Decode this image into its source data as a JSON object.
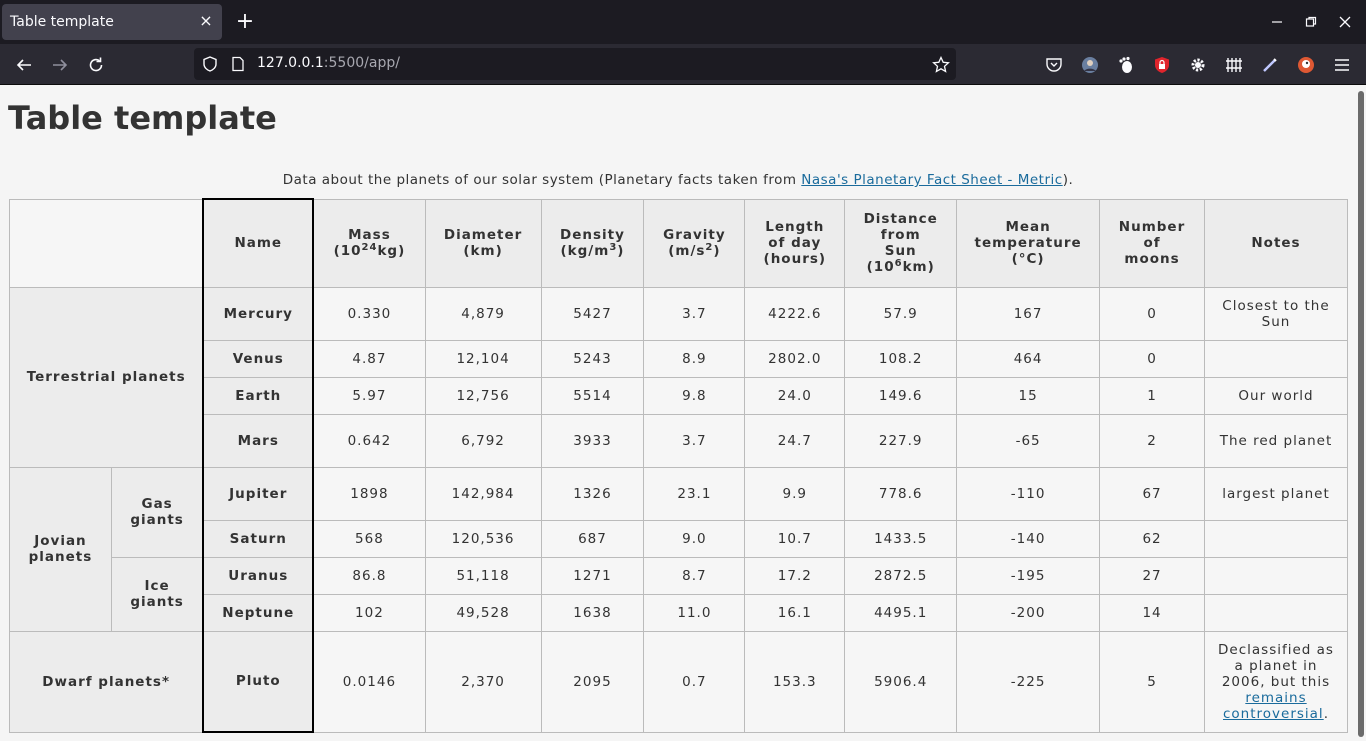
{
  "browser": {
    "tab_title": "Table template",
    "tab_close": "×",
    "new_tab": "+",
    "url_host": "127.0.0.1",
    "url_rest": ":5500/app/"
  },
  "page": {
    "title": "Table template",
    "caption_prefix": "Data about the planets of our solar system (Planetary facts taken from ",
    "caption_link": "Nasa's Planetary Fact Sheet - Metric",
    "caption_suffix": ")."
  },
  "table": {
    "headers": {
      "name": "Name",
      "mass": "Mass",
      "mass_unit_a": "(10",
      "mass_unit_sup": "24",
      "mass_unit_b": "kg)",
      "diameter": "Diameter",
      "diameter_unit": "(km)",
      "density": "Density",
      "density_unit_a": "(kg/m",
      "density_unit_sup": "3",
      "density_unit_b": ")",
      "gravity": "Gravity",
      "gravity_unit_a": "(m/s",
      "gravity_unit_sup": "2",
      "gravity_unit_b": ")",
      "length_day_1": "Length",
      "length_day_2": "of day",
      "length_day_3": "(hours)",
      "distance_1": "Distance",
      "distance_2": "from",
      "distance_3": "Sun",
      "distance_unit_a": "(10",
      "distance_unit_sup": "6",
      "distance_unit_b": "km)",
      "mean_temp_1": "Mean",
      "mean_temp_2": "temperature",
      "mean_temp_3": "(°C)",
      "moons_1": "Number",
      "moons_2": "of",
      "moons_3": "moons",
      "notes": "Notes"
    },
    "groups": {
      "terrestrial": "Terrestrial planets",
      "jovian": "Jovian planets",
      "gas_giants": "Gas giants",
      "ice_giants": "Ice giants",
      "dwarf": "Dwarf planets*"
    },
    "rows": [
      {
        "name": "Mercury",
        "mass": "0.330",
        "diameter": "4,879",
        "density": "5427",
        "gravity": "3.7",
        "day": "4222.6",
        "distance": "57.9",
        "temp": "167",
        "moons": "0",
        "notes": "Closest to the Sun"
      },
      {
        "name": "Venus",
        "mass": "4.87",
        "diameter": "12,104",
        "density": "5243",
        "gravity": "8.9",
        "day": "2802.0",
        "distance": "108.2",
        "temp": "464",
        "moons": "0",
        "notes": ""
      },
      {
        "name": "Earth",
        "mass": "5.97",
        "diameter": "12,756",
        "density": "5514",
        "gravity": "9.8",
        "day": "24.0",
        "distance": "149.6",
        "temp": "15",
        "moons": "1",
        "notes": "Our world"
      },
      {
        "name": "Mars",
        "mass": "0.642",
        "diameter": "6,792",
        "density": "3933",
        "gravity": "3.7",
        "day": "24.7",
        "distance": "227.9",
        "temp": "-65",
        "moons": "2",
        "notes": "The red planet"
      },
      {
        "name": "Jupiter",
        "mass": "1898",
        "diameter": "142,984",
        "density": "1326",
        "gravity": "23.1",
        "day": "9.9",
        "distance": "778.6",
        "temp": "-110",
        "moons": "67",
        "notes": "largest planet"
      },
      {
        "name": "Saturn",
        "mass": "568",
        "diameter": "120,536",
        "density": "687",
        "gravity": "9.0",
        "day": "10.7",
        "distance": "1433.5",
        "temp": "-140",
        "moons": "62",
        "notes": ""
      },
      {
        "name": "Uranus",
        "mass": "86.8",
        "diameter": "51,118",
        "density": "1271",
        "gravity": "8.7",
        "day": "17.2",
        "distance": "2872.5",
        "temp": "-195",
        "moons": "27",
        "notes": ""
      },
      {
        "name": "Neptune",
        "mass": "102",
        "diameter": "49,528",
        "density": "1638",
        "gravity": "11.0",
        "day": "16.1",
        "distance": "4495.1",
        "temp": "-200",
        "moons": "14",
        "notes": ""
      },
      {
        "name": "Pluto",
        "mass": "0.0146",
        "diameter": "2,370",
        "density": "2095",
        "gravity": "0.7",
        "day": "153.3",
        "distance": "5906.4",
        "temp": "-225",
        "moons": "5",
        "notes": ""
      }
    ],
    "pluto_note_prefix": "Declassified as a planet in 2006, but this ",
    "pluto_note_link": "remains controversial",
    "pluto_note_suffix": "."
  }
}
